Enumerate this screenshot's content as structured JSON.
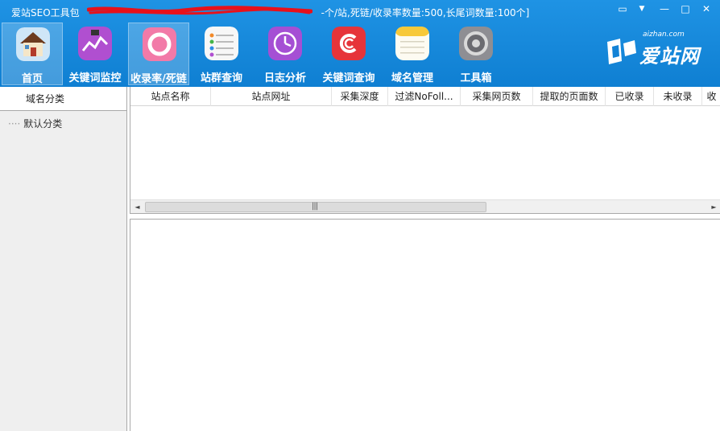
{
  "app": {
    "title": "爱站SEO工具包",
    "title_suffix": "-个/站,死链/收录率数量:500,长尾词数量:100个]"
  },
  "window_controls": {
    "chat": "▭",
    "menu": "▼",
    "minimize": "—",
    "maximize": "□",
    "close": "✕"
  },
  "toolbar": {
    "items": [
      {
        "label": "首页",
        "icon": "house-icon",
        "active": true
      },
      {
        "label": "关键词监控",
        "icon": "chart-icon"
      },
      {
        "label": "收录率/死链",
        "icon": "ring-icon",
        "active": true
      },
      {
        "label": "站群查询",
        "icon": "list-icon"
      },
      {
        "label": "日志分析",
        "icon": "clock-icon"
      },
      {
        "label": "关键词查询",
        "icon": "c-icon"
      },
      {
        "label": "域名管理",
        "icon": "notes-icon"
      },
      {
        "label": "工具箱",
        "icon": "settings-icon"
      }
    ]
  },
  "logo": {
    "sub": "aizhan.com",
    "main": "爱站网"
  },
  "sidebar": {
    "header": "域名分类",
    "items": [
      {
        "label": "默认分类"
      }
    ]
  },
  "grid": {
    "columns": [
      "站点名称",
      "站点网址",
      "采集深度",
      "过滤NoFoll...",
      "采集网页数",
      "提取的页面数",
      "已收录",
      "未收录",
      "收"
    ],
    "rows": []
  },
  "scrollbar": {
    "left": "◄",
    "right": "►",
    "grip": "|||"
  },
  "colors": {
    "topbar": "#1a8ae0",
    "panel_bg": "#efefef"
  }
}
